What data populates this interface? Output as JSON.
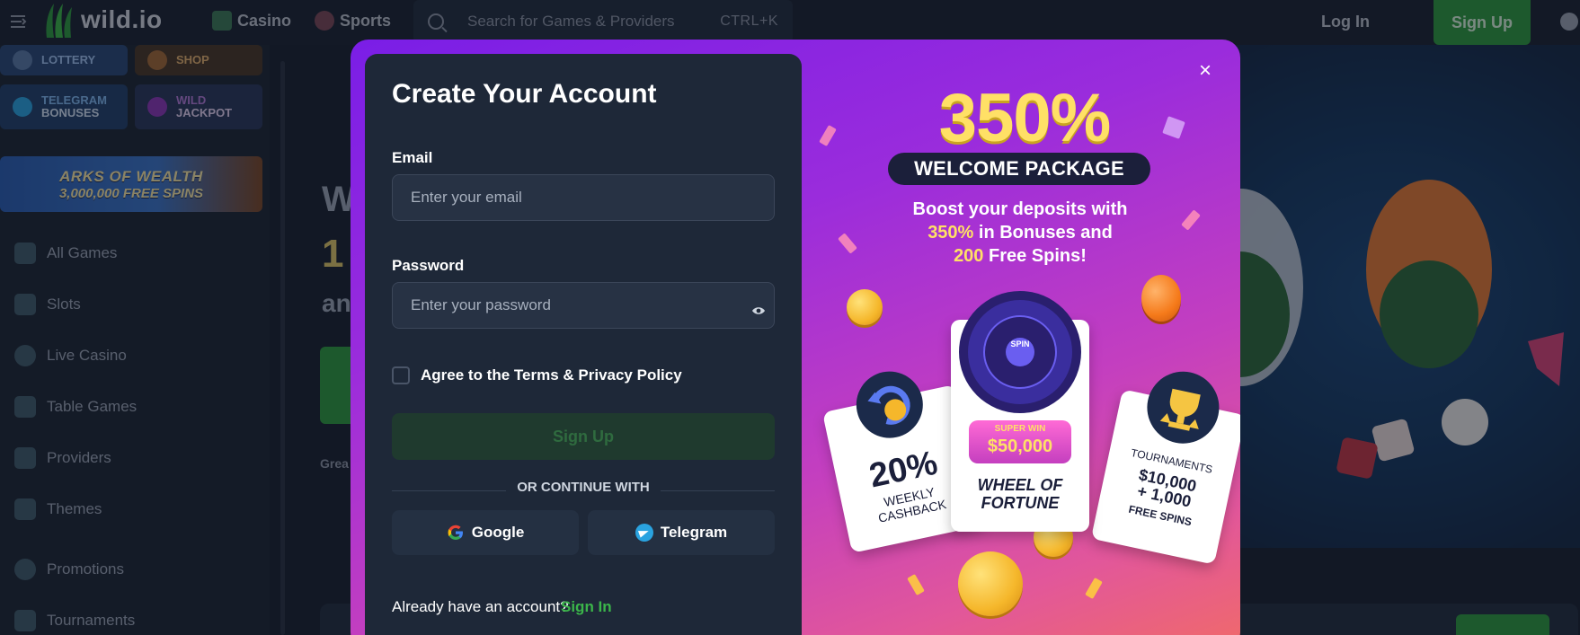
{
  "header": {
    "logo_text": "wild.io",
    "nav": [
      {
        "label": "Casino"
      },
      {
        "label": "Sports"
      }
    ],
    "search_placeholder": "Search for Games & Providers",
    "search_shortcut": "CTRL+K",
    "login_label": "Log In",
    "signup_label": "Sign Up"
  },
  "sidebar": {
    "tiles": [
      {
        "label_l1": "",
        "label_l2": "LOTTERY"
      },
      {
        "label_l1": "",
        "label_l2": "SHOP"
      },
      {
        "label_l1": "TELEGRAM",
        "label_l2": "BONUSES"
      },
      {
        "label_l1": "WILD",
        "label_l2": "JACKPOT"
      }
    ],
    "banner": {
      "line1": "ARKS OF WEALTH",
      "line2": "3,000,000 FREE SPINS"
    },
    "items": [
      {
        "label": "All Games"
      },
      {
        "label": "Slots"
      },
      {
        "label": "Live Casino"
      },
      {
        "label": "Table Games"
      },
      {
        "label": "Providers"
      },
      {
        "label": "Themes"
      },
      {
        "label": "Promotions"
      },
      {
        "label": "Tournaments"
      }
    ]
  },
  "background": {
    "partial_w": "W",
    "partial_1": "1",
    "partial_an": "an",
    "partial_grea": "Grea"
  },
  "modal": {
    "title": "Create Your Account",
    "email_label": "Email",
    "email_placeholder": "Enter your email",
    "password_label": "Password",
    "password_placeholder": "Enter your password",
    "terms_label": "Agree to the Terms & Privacy Policy",
    "signup_button": "Sign Up",
    "divider_text": "OR CONTINUE WITH",
    "google_label": "Google",
    "telegram_label": "Telegram",
    "have_account": "Already have an account?",
    "signin_link": "Sign In",
    "close_symbol": "×"
  },
  "promo": {
    "percent": "350%",
    "pill": "WELCOME PACKAGE",
    "desc_l1": "Boost your deposits with",
    "desc_hl1": "350%",
    "desc_l2": " in Bonuses and",
    "desc_hl2": "200",
    "desc_l3": " Free Spins!",
    "wheel_badge": "SUPER WIN",
    "wheel_amount": "$50,000",
    "wheel_title_l1": "WHEEL OF",
    "wheel_title_l2": "FORTUNE",
    "wheel_center": "SPIN",
    "cashback_pct": "20%",
    "cashback_l1": "WEEKLY",
    "cashback_l2": "CASHBACK",
    "tourn_label": "TOURNAMENTS",
    "tourn_l1": "$10,000",
    "tourn_l2": "+ 1,000",
    "tourn_l3": "FREE SPINS"
  },
  "colors": {
    "accent_green": "#2f9a42",
    "promo_yellow": "#ffe066",
    "panel_bg": "#1e2838"
  }
}
